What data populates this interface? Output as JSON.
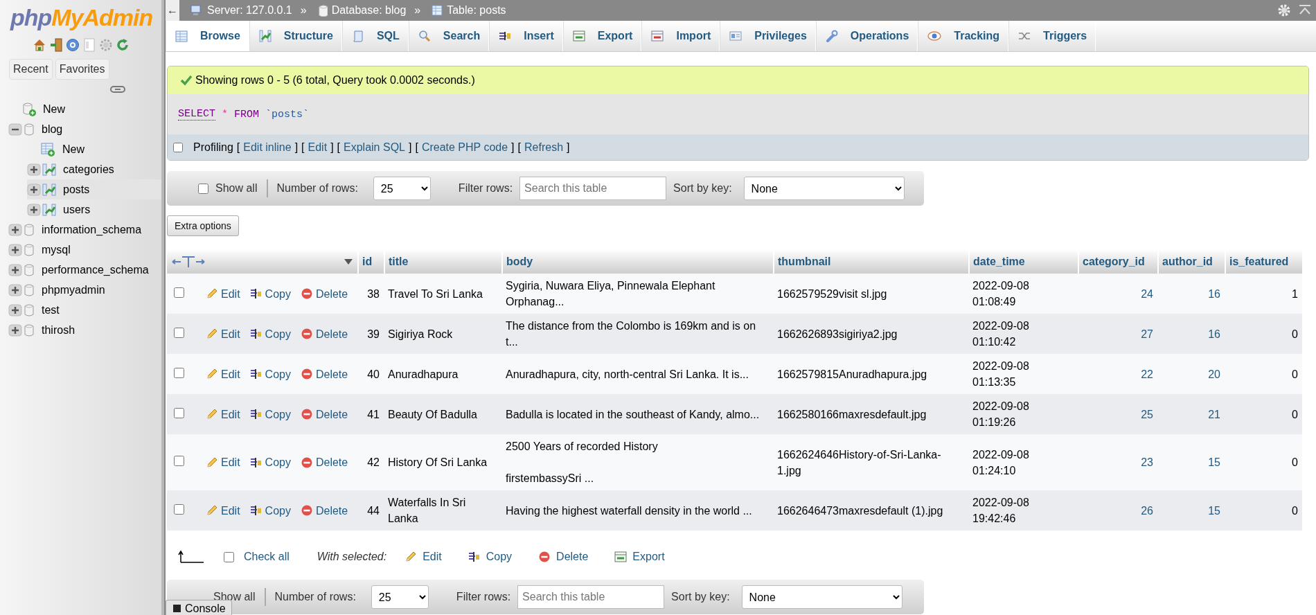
{
  "sidebar": {
    "logo": [
      "php",
      "MyAdmin"
    ],
    "buttons": [
      "Recent",
      "Favorites"
    ],
    "tree": [
      {
        "label": "New",
        "kind": "new",
        "selected": false
      },
      {
        "label": "blog",
        "kind": "database",
        "expanded": true,
        "selected": false,
        "children": [
          {
            "label": "New",
            "kind": "new-table",
            "selected": false
          },
          {
            "label": "categories",
            "kind": "table",
            "expanded": false,
            "selected": false
          },
          {
            "label": "posts",
            "kind": "table",
            "expanded": false,
            "selected": true
          },
          {
            "label": "users",
            "kind": "table",
            "expanded": false,
            "selected": false
          }
        ]
      },
      {
        "label": "information_schema",
        "kind": "database",
        "expanded": false,
        "selected": false
      },
      {
        "label": "mysql",
        "kind": "database",
        "expanded": false,
        "selected": false
      },
      {
        "label": "performance_schema",
        "kind": "database",
        "expanded": false,
        "selected": false
      },
      {
        "label": "phpmyadmin",
        "kind": "database",
        "expanded": false,
        "selected": false
      },
      {
        "label": "test",
        "kind": "database",
        "expanded": false,
        "selected": false
      },
      {
        "label": "thirosh",
        "kind": "database",
        "expanded": false,
        "selected": false
      }
    ]
  },
  "top_bar": {
    "back": "←",
    "separator": "»",
    "breadcrumb": [
      {
        "label": "Server: 127.0.0.1",
        "kind": "server"
      },
      {
        "label": "Database: blog",
        "kind": "database"
      },
      {
        "label": "Table: posts",
        "kind": "table"
      }
    ]
  },
  "tabs": [
    {
      "label": "Browse",
      "kind": "browse",
      "selected": true
    },
    {
      "label": "Structure",
      "kind": "structure",
      "selected": false
    },
    {
      "label": "SQL",
      "kind": "sql",
      "selected": false
    },
    {
      "label": "Search",
      "kind": "search",
      "selected": false
    },
    {
      "label": "Insert",
      "kind": "insert",
      "selected": false
    },
    {
      "label": "Export",
      "kind": "export",
      "selected": false
    },
    {
      "label": "Import",
      "kind": "import",
      "selected": false
    },
    {
      "label": "Privileges",
      "kind": "privileges",
      "selected": false
    },
    {
      "label": "Operations",
      "kind": "operations",
      "selected": false
    },
    {
      "label": "Tracking",
      "kind": "tracking",
      "selected": false
    },
    {
      "label": "Triggers",
      "kind": "triggers",
      "selected": false
    }
  ],
  "message": "Showing rows 0 - 5 (6 total, Query took 0.0002 seconds.)",
  "sql": {
    "select": "SELECT",
    "star": "*",
    "from": "FROM",
    "table": "`posts`"
  },
  "profiling": {
    "label": "Profiling",
    "checked": false,
    "open": "[",
    "close": "]",
    "links": [
      "Edit inline",
      "Edit",
      "Explain SQL",
      "Create PHP code",
      "Refresh"
    ]
  },
  "nav_top": {
    "show_all": {
      "label": "Show all",
      "checked": false
    },
    "rows_label": "Number of rows:",
    "rows_value": "25",
    "filter_label": "Filter rows:",
    "filter_placeholder": "Search this table",
    "sort_label": "Sort by key:",
    "sort_value": "None"
  },
  "extra_options": "Extra options",
  "table": {
    "columns": [
      {
        "label": "id",
        "kind": "number"
      },
      {
        "label": "title",
        "kind": "text"
      },
      {
        "label": "body",
        "kind": "text"
      },
      {
        "label": "thumbnail",
        "kind": "text"
      },
      {
        "label": "date_time",
        "kind": "text"
      },
      {
        "label": "category_id",
        "kind": "key"
      },
      {
        "label": "author_id",
        "kind": "key"
      },
      {
        "label": "is_featured",
        "kind": "number"
      }
    ],
    "rows": [
      {
        "checked": false,
        "actions": [
          {
            "label": "Edit",
            "kind": "edit"
          },
          {
            "label": "Copy",
            "kind": "copy"
          },
          {
            "label": "Delete",
            "kind": "delete"
          }
        ],
        "cells": [
          "38",
          "Travel To Sri Lanka",
          "Sygiria, Nuwara Eliya, Pinnewala Elephant Orphanag...",
          "1662579529visit sl.jpg",
          "2022-09-08 01:08:49",
          "24",
          "16",
          "1"
        ]
      },
      {
        "checked": false,
        "actions": [
          {
            "label": "Edit",
            "kind": "edit"
          },
          {
            "label": "Copy",
            "kind": "copy"
          },
          {
            "label": "Delete",
            "kind": "delete"
          }
        ],
        "cells": [
          "39",
          "Sigiriya Rock",
          "The distance from the Colombo is 169km and is on t...",
          "1662626893sigiriya2.jpg",
          "2022-09-08 01:10:42",
          "27",
          "16",
          "0"
        ]
      },
      {
        "checked": false,
        "actions": [
          {
            "label": "Edit",
            "kind": "edit"
          },
          {
            "label": "Copy",
            "kind": "copy"
          },
          {
            "label": "Delete",
            "kind": "delete"
          }
        ],
        "cells": [
          "40",
          "Anuradhapura",
          "Anuradhapura, city, north-central Sri Lanka. It is...",
          "1662579815Anuradhapura.jpg",
          "2022-09-08 01:13:35",
          "22",
          "20",
          "0"
        ]
      },
      {
        "checked": false,
        "actions": [
          {
            "label": "Edit",
            "kind": "edit"
          },
          {
            "label": "Copy",
            "kind": "copy"
          },
          {
            "label": "Delete",
            "kind": "delete"
          }
        ],
        "cells": [
          "41",
          "Beauty Of Badulla",
          "Badulla is located in the southeast of Kandy, almo...",
          "1662580166maxresdefault.jpg",
          "2022-09-08 01:19:26",
          "25",
          "21",
          "0"
        ]
      },
      {
        "checked": false,
        "actions": [
          {
            "label": "Edit",
            "kind": "edit"
          },
          {
            "label": "Copy",
            "kind": "copy"
          },
          {
            "label": "Delete",
            "kind": "delete"
          }
        ],
        "cells": [
          "42",
          "History Of Sri Lanka",
          "2500 Years of recorded History\n\nfirstembassySri ...",
          "1662624646History-of-Sri-Lanka-1.jpg",
          "2022-09-08 01:24:10",
          "23",
          "15",
          "0"
        ]
      },
      {
        "checked": false,
        "actions": [
          {
            "label": "Edit",
            "kind": "edit"
          },
          {
            "label": "Copy",
            "kind": "copy"
          },
          {
            "label": "Delete",
            "kind": "delete"
          }
        ],
        "cells": [
          "44",
          "Waterfalls In Sri Lanka",
          "Having the highest waterfall density in the world ...",
          "1662646473maxresdefault (1).jpg",
          "2022-09-08 19:42:46",
          "26",
          "15",
          "0"
        ]
      }
    ]
  },
  "bulk": {
    "checked": false,
    "check_all": "Check all",
    "with_selected": "With selected:",
    "actions": [
      {
        "label": "Edit",
        "kind": "edit"
      },
      {
        "label": "Copy",
        "kind": "copy"
      },
      {
        "label": "Delete",
        "kind": "delete"
      },
      {
        "label": "Export",
        "kind": "export"
      }
    ]
  },
  "nav_bottom": {
    "show_all": "Show all",
    "rows_label": "Number of rows:",
    "rows_value": "25",
    "filter_label": "Filter rows:",
    "filter_placeholder": "Search this table",
    "sort_label": "Sort by key:",
    "sort_value": "None"
  },
  "console": "Console"
}
